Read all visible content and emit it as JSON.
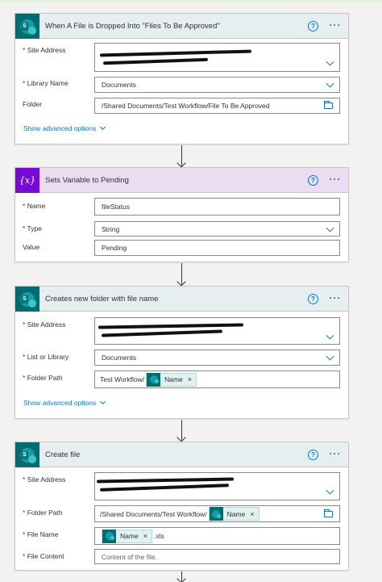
{
  "cards": [
    {
      "title": "When A File is Dropped Into \"Files To Be Approved\"",
      "fields": [
        {
          "label": "Site Address",
          "required": true
        },
        {
          "label": "Library Name",
          "required": true,
          "value": "Documents"
        },
        {
          "label": "Folder",
          "required": false,
          "value": "/Shared Documents/Test Workflow/File To Be Approved"
        }
      ],
      "advanced": "Show advanced options"
    },
    {
      "title": "Sets Variable to Pending",
      "icon_text": "{x}",
      "fields": [
        {
          "label": "Name",
          "required": true,
          "value": "fileStatus"
        },
        {
          "label": "Type",
          "required": true,
          "value": "String"
        },
        {
          "label": "Value",
          "required": false,
          "value": "Pending"
        }
      ]
    },
    {
      "title": "Creates new folder with file name",
      "fields": [
        {
          "label": "Site Address",
          "required": true
        },
        {
          "label": "List or Library",
          "required": true,
          "value": "Documents"
        },
        {
          "label": "Folder Path",
          "required": true,
          "prefix": "Test Workflow/",
          "token": "Name"
        }
      ],
      "advanced": "Show advanced options"
    },
    {
      "title": "Create file",
      "fields": [
        {
          "label": "Site Address",
          "required": true
        },
        {
          "label": "Folder Path",
          "required": true,
          "prefix": "/Shared Documents/Test Workflow/",
          "token": "Name"
        },
        {
          "label": "File Name",
          "required": true,
          "token": "Name",
          "suffix": ".xls"
        },
        {
          "label": "File Content",
          "required": true,
          "placeholder": "Content of the file."
        }
      ]
    }
  ],
  "help_glyph": "?",
  "more_glyph": "···",
  "required_mark": "*",
  "token_close": "×",
  "colors": {
    "accent": "#0078d4",
    "sharepoint": "#036c70",
    "variable": "#770bd6"
  }
}
